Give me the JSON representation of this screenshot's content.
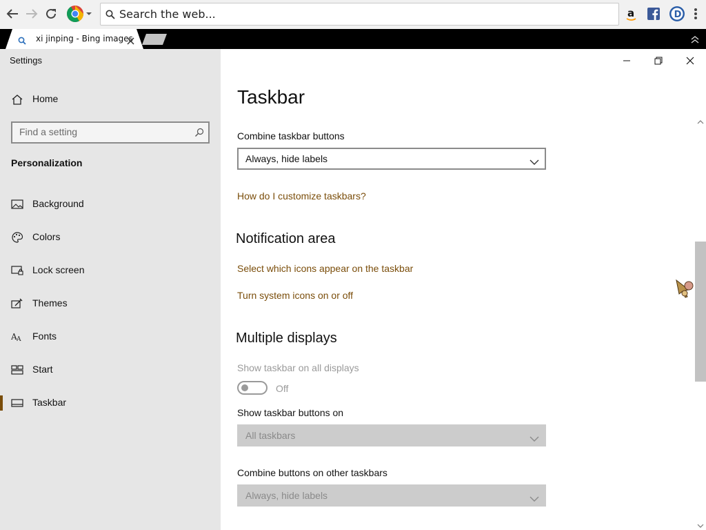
{
  "browser": {
    "omnibox_placeholder": "Search the web...",
    "tab_title": "xi jinping - Bing images",
    "icons": [
      "back-icon",
      "forward-icon",
      "reload-icon",
      "chrome-logo-icon",
      "amazon-icon",
      "facebook-icon",
      "d-extension-icon",
      "menu-icon"
    ]
  },
  "settings": {
    "window_title": "Settings",
    "home_label": "Home",
    "search_placeholder": "Find a setting",
    "section_title": "Personalization",
    "nav": [
      {
        "label": "Background",
        "icon": "picture-icon"
      },
      {
        "label": "Colors",
        "icon": "palette-icon"
      },
      {
        "label": "Lock screen",
        "icon": "lock-screen-icon"
      },
      {
        "label": "Themes",
        "icon": "themes-icon"
      },
      {
        "label": "Fonts",
        "icon": "fonts-icon"
      },
      {
        "label": "Start",
        "icon": "start-icon"
      },
      {
        "label": "Taskbar",
        "icon": "taskbar-icon"
      }
    ],
    "selected_nav": "Taskbar",
    "accent_color": "#7a4d0a"
  },
  "content": {
    "title": "Taskbar",
    "combine_label": "Combine taskbar buttons",
    "combine_value": "Always, hide labels",
    "customize_link": "How do I customize taskbars?",
    "notification_heading": "Notification area",
    "select_icons_link": "Select which icons appear on the taskbar",
    "system_icons_link": "Turn system icons on or off",
    "multiple_heading": "Multiple displays",
    "show_all_label": "Show taskbar on all displays",
    "show_all_state": "Off",
    "show_buttons_label": "Show taskbar buttons on",
    "show_buttons_value": "All taskbars",
    "combine_other_label": "Combine buttons on other taskbars",
    "combine_other_value": "Always, hide labels"
  }
}
